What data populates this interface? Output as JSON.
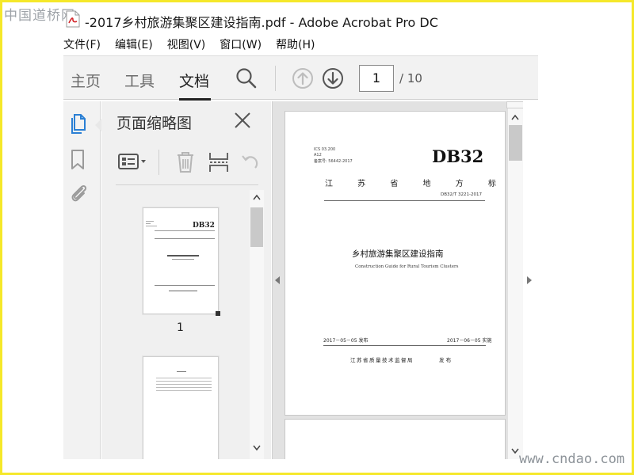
{
  "watermark": {
    "logo": "中国道桥网",
    "url": "www.cndao.com"
  },
  "window": {
    "title": "-2017乡村旅游集聚区建设指南.pdf - Adobe Acrobat Pro DC",
    "icon": "pdf-file-icon"
  },
  "menu": [
    "文件(F)",
    "编辑(E)",
    "视图(V)",
    "窗口(W)",
    "帮助(H)"
  ],
  "toolbar": {
    "tabs": [
      {
        "label": "主页",
        "active": false
      },
      {
        "label": "工具",
        "active": false
      },
      {
        "label": "文档",
        "active": true
      }
    ],
    "icons": [
      "search-icon",
      "previous-page-icon",
      "next-page-icon"
    ],
    "current_page": "1",
    "page_total": "/ 10"
  },
  "rail": {
    "icons": [
      "page-thumbnails-icon",
      "bookmark-icon",
      "attachment-icon"
    ],
    "active": "page-thumbnails-icon"
  },
  "thumbnail_pane": {
    "title": "页面缩略图",
    "tools": [
      "thumbnail-options-icon",
      "delete-icon",
      "extract-icon",
      "undo-icon"
    ],
    "pages": [
      {
        "label": "1"
      },
      {
        "label": ""
      }
    ]
  },
  "document": {
    "page1": {
      "meta": [
        "ICS 03.200",
        "A12",
        "备案号: 56442-2017"
      ],
      "standard_code": "DB32",
      "region": "江 苏 省 地 方 标 准",
      "doc_number": "DB32/T 3221-2017",
      "title_cn": "乡村旅游集聚区建设指南",
      "title_en": "Construction Guide for Rural Tourism Clusters",
      "release_date": "2017－05－05 发布",
      "effective_date": "2017－06－05 实施",
      "issuer": "江苏省质量技术监督局",
      "issuer_suffix": "发 布"
    }
  },
  "colors": {
    "border": "#f5e82a",
    "toolbar_bg": "#f2f2f2",
    "doc_bg": "#e2e2e2"
  }
}
